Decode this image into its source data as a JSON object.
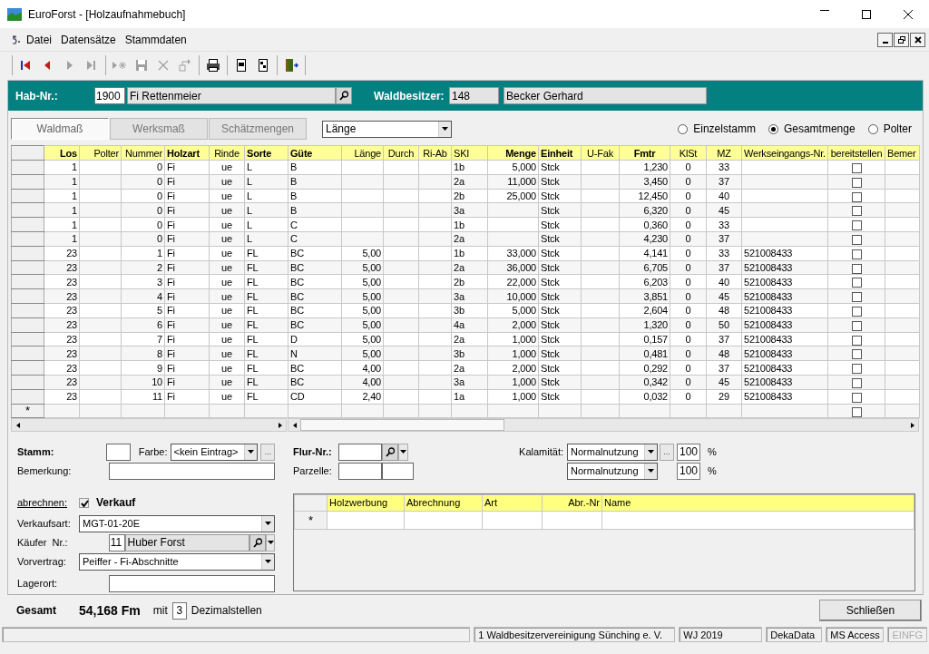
{
  "window": {
    "title": "EuroForst - [Holzaufnahmebuch]"
  },
  "menu": [
    "Datei",
    "Datensätze",
    "Stammdaten"
  ],
  "toolbar": [
    [
      {
        "kind": "first",
        "disabled": false
      },
      {
        "kind": "prev",
        "disabled": false
      },
      {
        "kind": "next",
        "disabled": true
      },
      {
        "kind": "last",
        "disabled": true
      }
    ],
    [
      {
        "kind": "new",
        "disabled": true
      },
      {
        "kind": "save",
        "disabled": true
      },
      {
        "kind": "delete",
        "disabled": true
      },
      {
        "kind": "undo",
        "disabled": true
      }
    ],
    [
      {
        "kind": "print",
        "disabled": false
      }
    ],
    [
      {
        "kind": "report1",
        "disabled": false
      },
      {
        "kind": "report2",
        "disabled": false
      }
    ],
    [
      {
        "kind": "exit",
        "disabled": false
      }
    ]
  ],
  "header": {
    "hab_label": "Hab-Nr.:",
    "hab_nr": "1900",
    "hab_name": "Fi Rettenmeier",
    "owner_label": "Waldbesitzer:",
    "owner_nr": "148",
    "owner_name": "Becker Gerhard"
  },
  "tabs": [
    {
      "label": "Waldmaß",
      "selected": true
    },
    {
      "label": "Werksmaß",
      "selected": false
    },
    {
      "label": "Schätzmengen",
      "selected": false
    }
  ],
  "measure_select": {
    "value": "Länge"
  },
  "modes": [
    {
      "label": "Einzelstamm",
      "selected": false
    },
    {
      "label": "Gesamtmenge",
      "selected": true
    },
    {
      "label": "Polter",
      "selected": false
    }
  ],
  "table": {
    "columns": [
      {
        "label": "Los",
        "required": true
      },
      {
        "label": "Polter",
        "required": false
      },
      {
        "label": "Nummer",
        "required": false
      },
      {
        "label": "Holzart",
        "required": true
      },
      {
        "label": "Rinde",
        "required": false
      },
      {
        "label": "Sorte",
        "required": true
      },
      {
        "label": "Güte",
        "required": true
      },
      {
        "label": "Länge",
        "required": false
      },
      {
        "label": "Durch",
        "required": false
      },
      {
        "label": "Ri-Ab",
        "required": false
      },
      {
        "label": "SKI",
        "required": false
      },
      {
        "label": "Menge",
        "required": true
      },
      {
        "label": "Einheit",
        "required": true
      },
      {
        "label": "U-Fak",
        "required": false
      },
      {
        "label": "Fmtr",
        "required": true
      },
      {
        "label": "KlSt",
        "required": false
      },
      {
        "label": "MZ",
        "required": false
      },
      {
        "label": "Werkseingangs-Nr.",
        "required": false
      },
      {
        "label": "bereitstellen",
        "required": false,
        "kind": "checkbox"
      },
      {
        "label": "Bemer",
        "required": false
      }
    ],
    "rows": [
      {
        "cells": [
          "1",
          null,
          "0",
          "Fi",
          "ue",
          "L",
          "B",
          null,
          null,
          null,
          "1b",
          "5,000",
          "Stck",
          null,
          "1,230",
          "0",
          "33",
          null
        ],
        "bereitstellen": false
      },
      {
        "cells": [
          "1",
          null,
          "0",
          "Fi",
          "ue",
          "L",
          "B",
          null,
          null,
          null,
          "2a",
          "11,000",
          "Stck",
          null,
          "3,450",
          "0",
          "37",
          null
        ],
        "bereitstellen": false
      },
      {
        "cells": [
          "1",
          null,
          "0",
          "Fi",
          "ue",
          "L",
          "B",
          null,
          null,
          null,
          "2b",
          "25,000",
          "Stck",
          null,
          "12,450",
          "0",
          "40",
          null
        ],
        "bereitstellen": false
      },
      {
        "cells": [
          "1",
          null,
          "0",
          "Fi",
          "ue",
          "L",
          "B",
          null,
          null,
          null,
          "3a",
          null,
          "Stck",
          null,
          "6,320",
          "0",
          "45",
          null
        ],
        "bereitstellen": false
      },
      {
        "cells": [
          "1",
          null,
          "0",
          "Fi",
          "ue",
          "L",
          "C",
          null,
          null,
          null,
          "1b",
          null,
          "Stck",
          null,
          "0,360",
          "0",
          "33",
          null
        ],
        "bereitstellen": false
      },
      {
        "cells": [
          "1",
          null,
          "0",
          "Fi",
          "ue",
          "L",
          "C",
          null,
          null,
          null,
          "2a",
          null,
          "Stck",
          null,
          "4,230",
          "0",
          "37",
          null
        ],
        "bereitstellen": false
      },
      {
        "cells": [
          "23",
          null,
          "1",
          "Fi",
          "ue",
          "FL",
          "BC",
          "5,00",
          null,
          null,
          "1b",
          "33,000",
          "Stck",
          null,
          "4,141",
          "0",
          "33",
          "521008433"
        ],
        "bereitstellen": false
      },
      {
        "cells": [
          "23",
          null,
          "2",
          "Fi",
          "ue",
          "FL",
          "BC",
          "5,00",
          null,
          null,
          "2a",
          "36,000",
          "Stck",
          null,
          "6,705",
          "0",
          "37",
          "521008433"
        ],
        "bereitstellen": false
      },
      {
        "cells": [
          "23",
          null,
          "3",
          "Fi",
          "ue",
          "FL",
          "BC",
          "5,00",
          null,
          null,
          "2b",
          "22,000",
          "Stck",
          null,
          "6,203",
          "0",
          "40",
          "521008433"
        ],
        "bereitstellen": false
      },
      {
        "cells": [
          "23",
          null,
          "4",
          "Fi",
          "ue",
          "FL",
          "BC",
          "5,00",
          null,
          null,
          "3a",
          "10,000",
          "Stck",
          null,
          "3,851",
          "0",
          "45",
          "521008433"
        ],
        "bereitstellen": false
      },
      {
        "cells": [
          "23",
          null,
          "5",
          "Fi",
          "ue",
          "FL",
          "BC",
          "5,00",
          null,
          null,
          "3b",
          "5,000",
          "Stck",
          null,
          "2,604",
          "0",
          "48",
          "521008433"
        ],
        "bereitstellen": false
      },
      {
        "cells": [
          "23",
          null,
          "6",
          "Fi",
          "ue",
          "FL",
          "BC",
          "5,00",
          null,
          null,
          "4a",
          "2,000",
          "Stck",
          null,
          "1,320",
          "0",
          "50",
          "521008433"
        ],
        "bereitstellen": false
      },
      {
        "cells": [
          "23",
          null,
          "7",
          "Fi",
          "ue",
          "FL",
          "D",
          "5,00",
          null,
          null,
          "2a",
          "1,000",
          "Stck",
          null,
          "0,157",
          "0",
          "37",
          "521008433"
        ],
        "bereitstellen": false
      },
      {
        "cells": [
          "23",
          null,
          "8",
          "Fi",
          "ue",
          "FL",
          "N",
          "5,00",
          null,
          null,
          "3b",
          "1,000",
          "Stck",
          null,
          "0,481",
          "0",
          "48",
          "521008433"
        ],
        "bereitstellen": false
      },
      {
        "cells": [
          "23",
          null,
          "9",
          "Fi",
          "ue",
          "FL",
          "BC",
          "4,00",
          null,
          null,
          "2a",
          "2,000",
          "Stck",
          null,
          "0,292",
          "0",
          "37",
          "521008433"
        ],
        "bereitstellen": false
      },
      {
        "cells": [
          "23",
          null,
          "10",
          "Fi",
          "ue",
          "FL",
          "BC",
          "4,00",
          null,
          null,
          "3a",
          "1,000",
          "Stck",
          null,
          "0,342",
          "0",
          "45",
          "521008433"
        ],
        "bereitstellen": false
      },
      {
        "cells": [
          "23",
          null,
          "11",
          "Fi",
          "ue",
          "FL",
          "CD",
          "2,40",
          null,
          null,
          "1a",
          "1,000",
          "Stck",
          null,
          "0,032",
          "0",
          "29",
          "521008433"
        ],
        "bereitstellen": false
      }
    ],
    "new_row": {
      "marker": "*",
      "bereitstellen": false
    }
  },
  "form": {
    "stamm": {
      "label": "Stamm:"
    },
    "farbe": {
      "label": "Farbe:",
      "value": "<kein Eintrag>",
      "more": "..."
    },
    "bemerkung": {
      "label": "Bemerkung:"
    },
    "flur": {
      "label": "Flur-Nr.:"
    },
    "parzelle": {
      "label": "Parzelle:"
    },
    "kalamitaet": {
      "label": "Kalamität:",
      "rows": [
        {
          "value": "Normalnutzung",
          "more": "...",
          "percent": "100",
          "unit": "%"
        },
        {
          "value": "Normalnutzung",
          "percent": "100",
          "unit": "%"
        }
      ]
    },
    "abrechnen": {
      "label": "abrechnen:",
      "checkbox_label": "Verkauf",
      "checked": true
    },
    "verkaufsart": {
      "label": "Verkaufsart:",
      "value": "MGT-01-20E"
    },
    "kaeufer": {
      "label": "Käufer  Nr.:",
      "nr": "11",
      "name": "Huber Forst"
    },
    "vorvertrag": {
      "label": "Vorvertrag:",
      "value": "Peiffer - Fi-Abschnitte"
    },
    "lagerort": {
      "label": "Lagerort:"
    }
  },
  "subtable": {
    "columns": [
      "Holzwerbung",
      "Abrechnung",
      "Art",
      "Abr.-Nr",
      "Name"
    ],
    "new_row_marker": "*"
  },
  "total": {
    "label": "Gesamt",
    "value": "54,168 Fm",
    "with": "mit",
    "decimals": "3",
    "decimals_label": "Dezimalstellen"
  },
  "close_button": "Schließen",
  "status_bar": [
    {
      "text": "1 Waldbesitzervereinigung Sünching e. V.",
      "disabled": false
    },
    {
      "text": "WJ 2019",
      "disabled": false
    },
    {
      "text": "DekaData",
      "disabled": false
    },
    {
      "text": "MS Access",
      "disabled": false
    },
    {
      "text": "EINFG",
      "disabled": true
    }
  ]
}
